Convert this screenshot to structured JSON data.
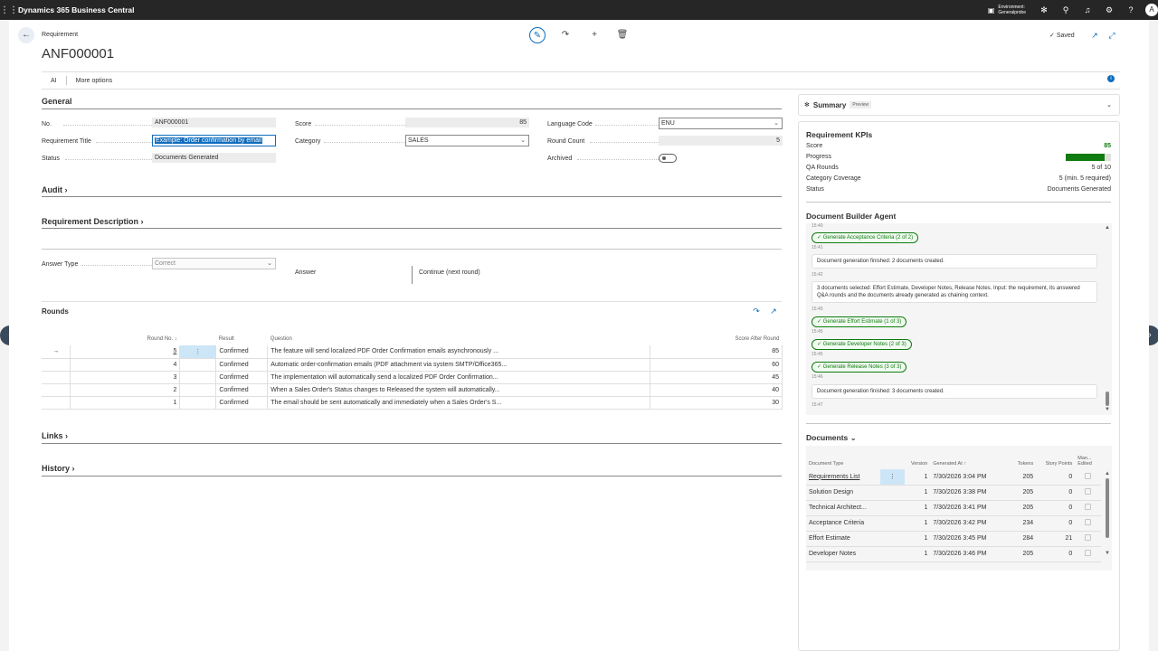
{
  "topbar": {
    "app_title": "Dynamics 365 Business Central",
    "environment_label": "Environment:",
    "environment_name": "Generalprobe",
    "avatar": "A"
  },
  "header": {
    "entity": "Requirement",
    "title": "ANF000001",
    "saved": "Saved"
  },
  "actionbar": {
    "ai": "AI",
    "more": "More options"
  },
  "general": {
    "title": "General",
    "no_label": "No.",
    "no_value": "ANF000001",
    "title_label": "Requirement Title",
    "title_value": "Example: Order confirmation by email",
    "status_label": "Status",
    "status_value": "Documents Generated",
    "score_label": "Score",
    "score_value": "85",
    "category_label": "Category",
    "category_value": "SALES",
    "lang_label": "Language Code",
    "lang_value": "ENU",
    "roundcount_label": "Round Count",
    "roundcount_value": "5",
    "archived_label": "Archived"
  },
  "sections": {
    "audit": "Audit",
    "description": "Requirement Description",
    "rounds": "Rounds",
    "links": "Links",
    "history": "History"
  },
  "answer": {
    "type_label": "Answer Type",
    "type_value": "Correct",
    "answer_label": "Answer",
    "answer_value": "Continue (next round)"
  },
  "rounds": {
    "headers": [
      "Round No.",
      "Result",
      "Question",
      "Score After Round"
    ],
    "rows": [
      {
        "no": "5",
        "result": "Confirmed",
        "question": "The feature will send localized PDF Order Confirmation emails asynchronously ...",
        "score": "85"
      },
      {
        "no": "4",
        "result": "Confirmed",
        "question": "Automatic order-confirmation emails (PDF attachment via system SMTP/Office365...",
        "score": "60"
      },
      {
        "no": "3",
        "result": "Confirmed",
        "question": "The implementation will automatically send a localized PDF Order Confirmation...",
        "score": "45"
      },
      {
        "no": "2",
        "result": "Confirmed",
        "question": "When a Sales Order's Status changes to Released the system will automatically...",
        "score": "40"
      },
      {
        "no": "1",
        "result": "Confirmed",
        "question": "The email should be sent automatically and immediately when a Sales Order's S...",
        "score": "30"
      }
    ]
  },
  "summary": {
    "title": "Summary",
    "preview": "Preview",
    "kpi_title": "Requirement KPIs",
    "kpis": [
      {
        "label": "Score",
        "value": "85"
      },
      {
        "label": "Progress",
        "value": ""
      },
      {
        "label": "QA Rounds",
        "value": "5 of 10"
      },
      {
        "label": "Category Coverage",
        "value": "5 (min. 5 required)"
      },
      {
        "label": "Status",
        "value": "Documents Generated"
      }
    ],
    "progress_fraction": 0.85,
    "score_color": "#107c10"
  },
  "agent": {
    "title": "Document Builder Agent",
    "times": [
      "15:40",
      "15:41",
      "15:42",
      "15:45",
      "15:45",
      "15:45",
      "15:46",
      "15:47"
    ],
    "chip1": "Generate Acceptance Criteria (2 of 2)",
    "msg1": "Document generation finished: 2 documents created.",
    "msg2": "3 documents selected: Effort Estimate, Developer Notes, Release Notes. Input: the requirement, its answered Q&A rounds and the documents already generated as chaining context.",
    "chip2": "Generate Effort Estimate (1 of 3)",
    "chip3": "Generate Developer Notes (2 of 3)",
    "chip4": "Generate Release Notes (3 of 3)",
    "msg3": "Document generation finished: 3 documents created."
  },
  "documents": {
    "title": "Documents",
    "headers": [
      "Document Type",
      "Version",
      "Generated At",
      "Tokens",
      "Story Points",
      "Man... Edited"
    ],
    "rows": [
      {
        "type": "Requirements List",
        "version": "1",
        "at": "7/30/2026 3:04 PM",
        "tokens": "205",
        "sp": "0"
      },
      {
        "type": "Solution Design",
        "version": "1",
        "at": "7/30/2026 3:38 PM",
        "tokens": "205",
        "sp": "0"
      },
      {
        "type": "Technical Architect...",
        "version": "1",
        "at": "7/30/2026 3:41 PM",
        "tokens": "205",
        "sp": "0"
      },
      {
        "type": "Acceptance Criteria",
        "version": "1",
        "at": "7/30/2026 3:42 PM",
        "tokens": "234",
        "sp": "0"
      },
      {
        "type": "Effort Estimate",
        "version": "1",
        "at": "7/30/2026 3:45 PM",
        "tokens": "284",
        "sp": "21"
      },
      {
        "type": "Developer Notes",
        "version": "1",
        "at": "7/30/2026 3:46 PM",
        "tokens": "205",
        "sp": "0"
      }
    ]
  },
  "colors": {
    "accent": "#0f6cbd",
    "success": "#107c10",
    "topbar": "#262626"
  }
}
